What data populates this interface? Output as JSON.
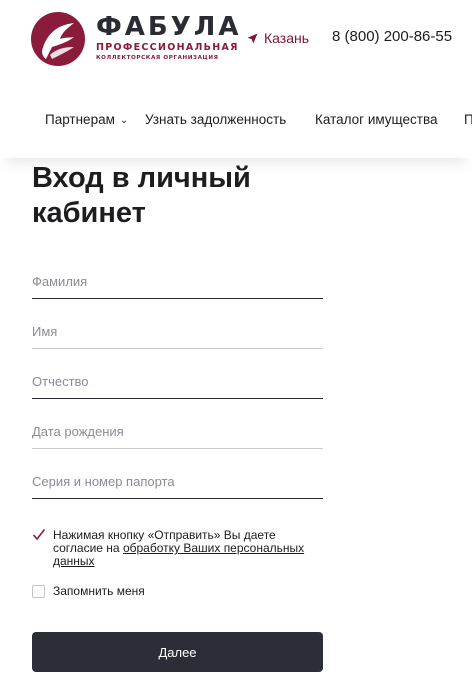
{
  "brand": {
    "name": "ФАБУЛА",
    "subtitle": "ПРОФЕССИОНАЛЬНАЯ",
    "subtitle2": "КОЛЛЕКТОРСКАЯ ОРГАНИЗАЦИЯ",
    "accent_color": "#8a1b3b"
  },
  "header": {
    "city": "Казань",
    "city_icon": "location-arrow-icon",
    "phone": "8 (800) 200-86-55"
  },
  "nav": {
    "items": [
      {
        "label": "Партнерам",
        "has_dropdown": true
      },
      {
        "label": "Узнать задолженность"
      },
      {
        "label": "Каталог имущества"
      },
      {
        "label": "П"
      }
    ]
  },
  "page": {
    "title": "Вход в личный кабинет"
  },
  "form": {
    "fields": [
      {
        "placeholder": "Фамилия",
        "value": ""
      },
      {
        "placeholder": "Имя",
        "value": ""
      },
      {
        "placeholder": "Отчество",
        "value": ""
      },
      {
        "placeholder": "Дата рождения",
        "value": ""
      },
      {
        "placeholder": "Серия и номер папорта",
        "value": ""
      }
    ],
    "consent": {
      "checked": true,
      "text_before": "Нажимая кнопку «Отправить» Вы даете согласие на ",
      "link_text": "обработку Ваших персональных данных"
    },
    "remember": {
      "checked": false,
      "label": "Запомнить меня"
    },
    "submit_label": "Далее"
  }
}
